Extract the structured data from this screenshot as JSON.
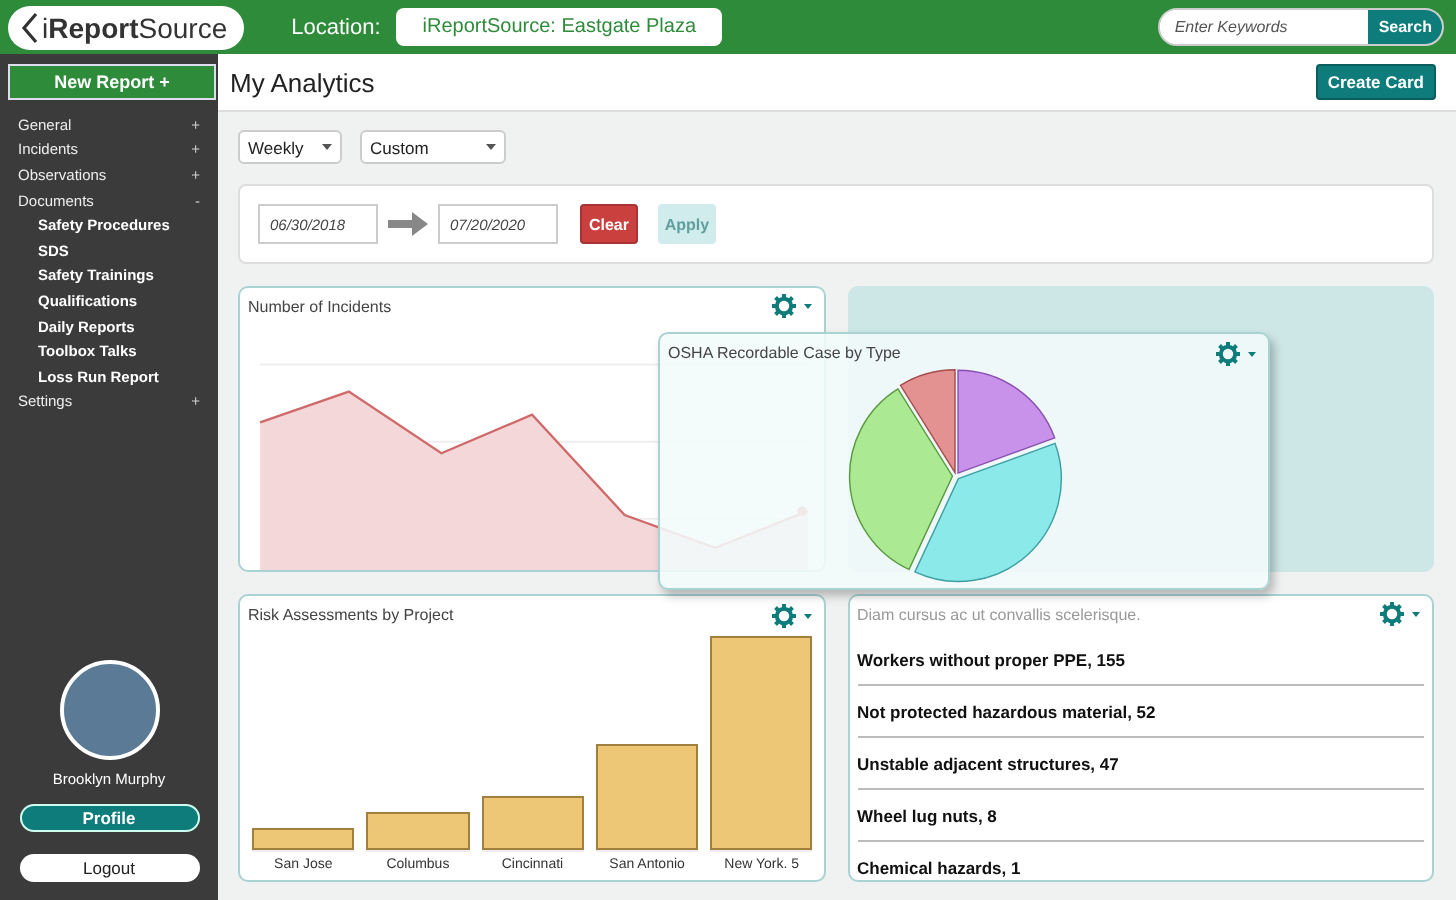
{
  "header": {
    "logo": "i**Report**Source",
    "location_label": "Location:",
    "location_value": "iReportSource: Eastgate Plaza",
    "search": {
      "placeholder": "Enter Keywords",
      "button": "Search"
    }
  },
  "sidebar": {
    "new_report": "New Report +",
    "items": [
      {
        "label": "General",
        "toggle": "+"
      },
      {
        "label": "Incidents",
        "toggle": "+"
      },
      {
        "label": "Observations",
        "toggle": "+"
      },
      {
        "label": "Documents",
        "toggle": "-",
        "children": [
          {
            "label": "Safety Procedures"
          },
          {
            "label": "SDS"
          },
          {
            "label": "Safety Trainings"
          },
          {
            "label": "Qualifications"
          },
          {
            "label": "Daily Reports"
          },
          {
            "label": "Toolbox Talks"
          },
          {
            "label": "Loss Run Report"
          }
        ]
      },
      {
        "label": "Settings",
        "toggle": "+"
      }
    ],
    "user_name": "Brooklyn Murphy",
    "profile_button": "Profile",
    "logout_button": "Logout"
  },
  "page": {
    "title": "My Analytics",
    "create_button": "Create Card"
  },
  "filters": {
    "period": "Weekly",
    "range": "Custom",
    "start_date": "06/30/2018",
    "end_date": "07/20/2020",
    "clear_button": "Clear",
    "apply_button": {
      "label": "Apply",
      "disabled": true
    }
  },
  "cards": [
    {
      "kind": "line",
      "title": "Number of Incidents"
    },
    {
      "kind": "blank"
    },
    {
      "kind": "bar",
      "title": "Risk Assessments by Project",
      "categories": [
        "San Jose",
        "Columbus",
        "Cincinnati",
        "San Antonio",
        "New York. 5"
      ]
    },
    {
      "kind": "list",
      "title": "Diam cursus ac ut convallis scelerisque.",
      "items": [
        "Workers without proper PPE, 155",
        "Not protected hazardous material, 52",
        "Unstable adjacent structures, 47",
        "Wheel lug nuts, 8",
        "Chemical hazards, 1"
      ]
    }
  ],
  "overlay_card": {
    "kind": "pie",
    "title": "OSHA Recordable Case by Type"
  }
}
